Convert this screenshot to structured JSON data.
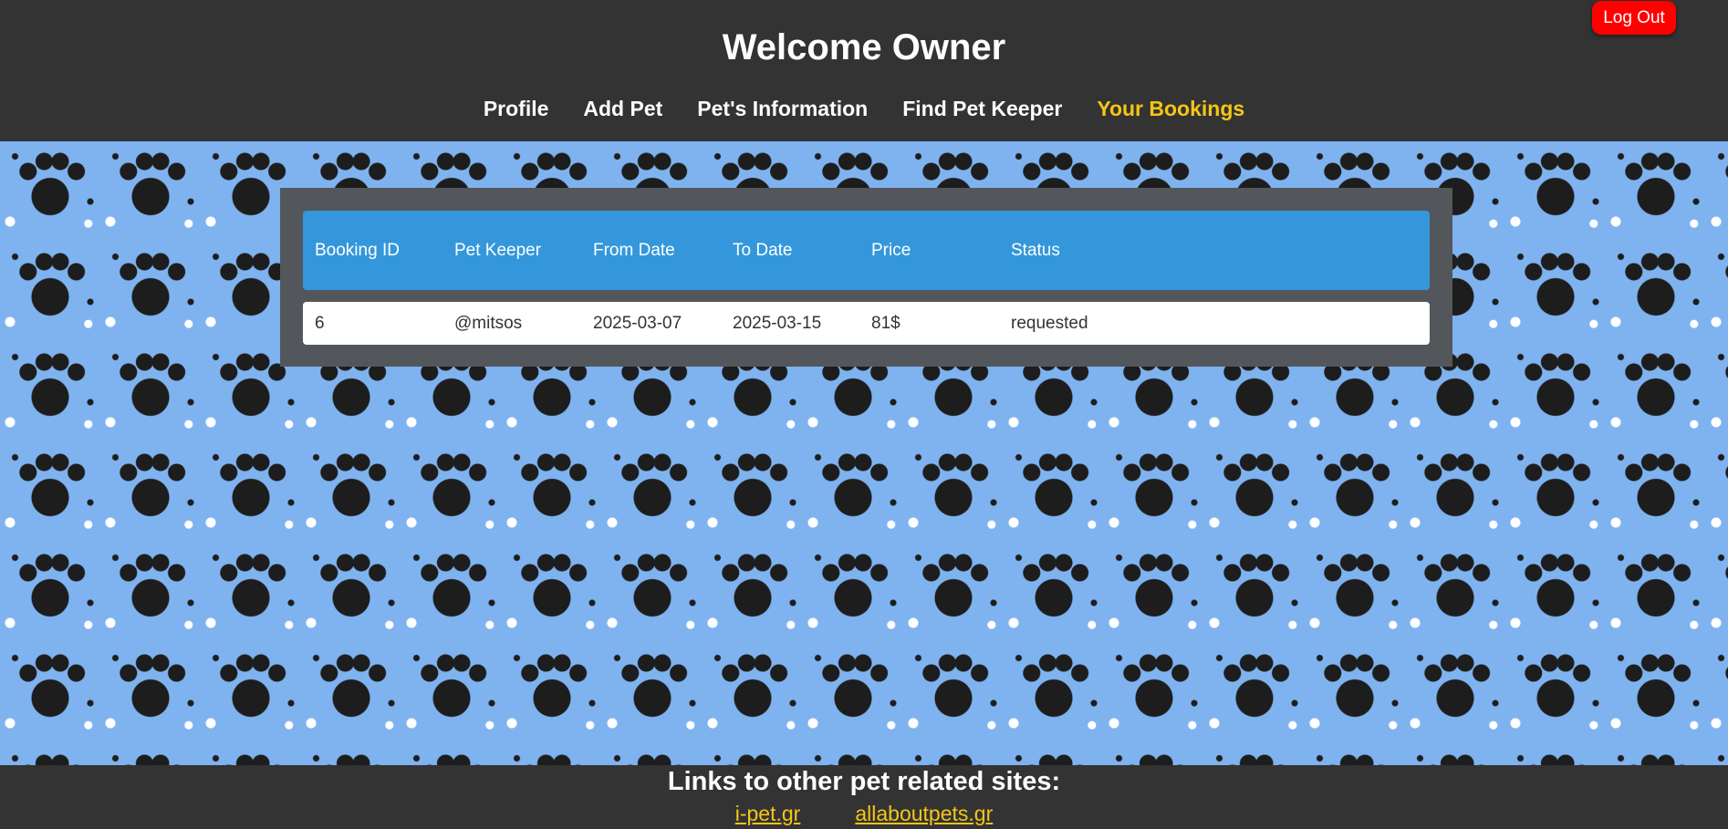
{
  "header": {
    "title": "Welcome Owner",
    "logout_label": "Log Out",
    "nav": [
      {
        "label": "Profile",
        "active": false
      },
      {
        "label": "Add Pet",
        "active": false
      },
      {
        "label": "Pet's Information",
        "active": false
      },
      {
        "label": "Find Pet Keeper",
        "active": false
      },
      {
        "label": "Your Bookings",
        "active": true
      }
    ]
  },
  "bookings": {
    "columns": [
      "Booking ID",
      "Pet Keeper",
      "From Date",
      "To Date",
      "Price",
      "Status"
    ],
    "rows": [
      [
        "6",
        "@mitsos",
        "2025-03-07",
        "2025-03-15",
        "81$",
        "requested"
      ]
    ]
  },
  "footer": {
    "title": "Links to other pet related sites:",
    "links": [
      "i-pet.gr",
      "allaboutpets.gr"
    ]
  },
  "colors": {
    "header_bg": "#333333",
    "active_nav": "#f5c518",
    "logout_bg": "#ff0000",
    "table_header_bg": "#3497db",
    "panel_bg": "#53575c",
    "page_bg": "#7fb3f0"
  }
}
